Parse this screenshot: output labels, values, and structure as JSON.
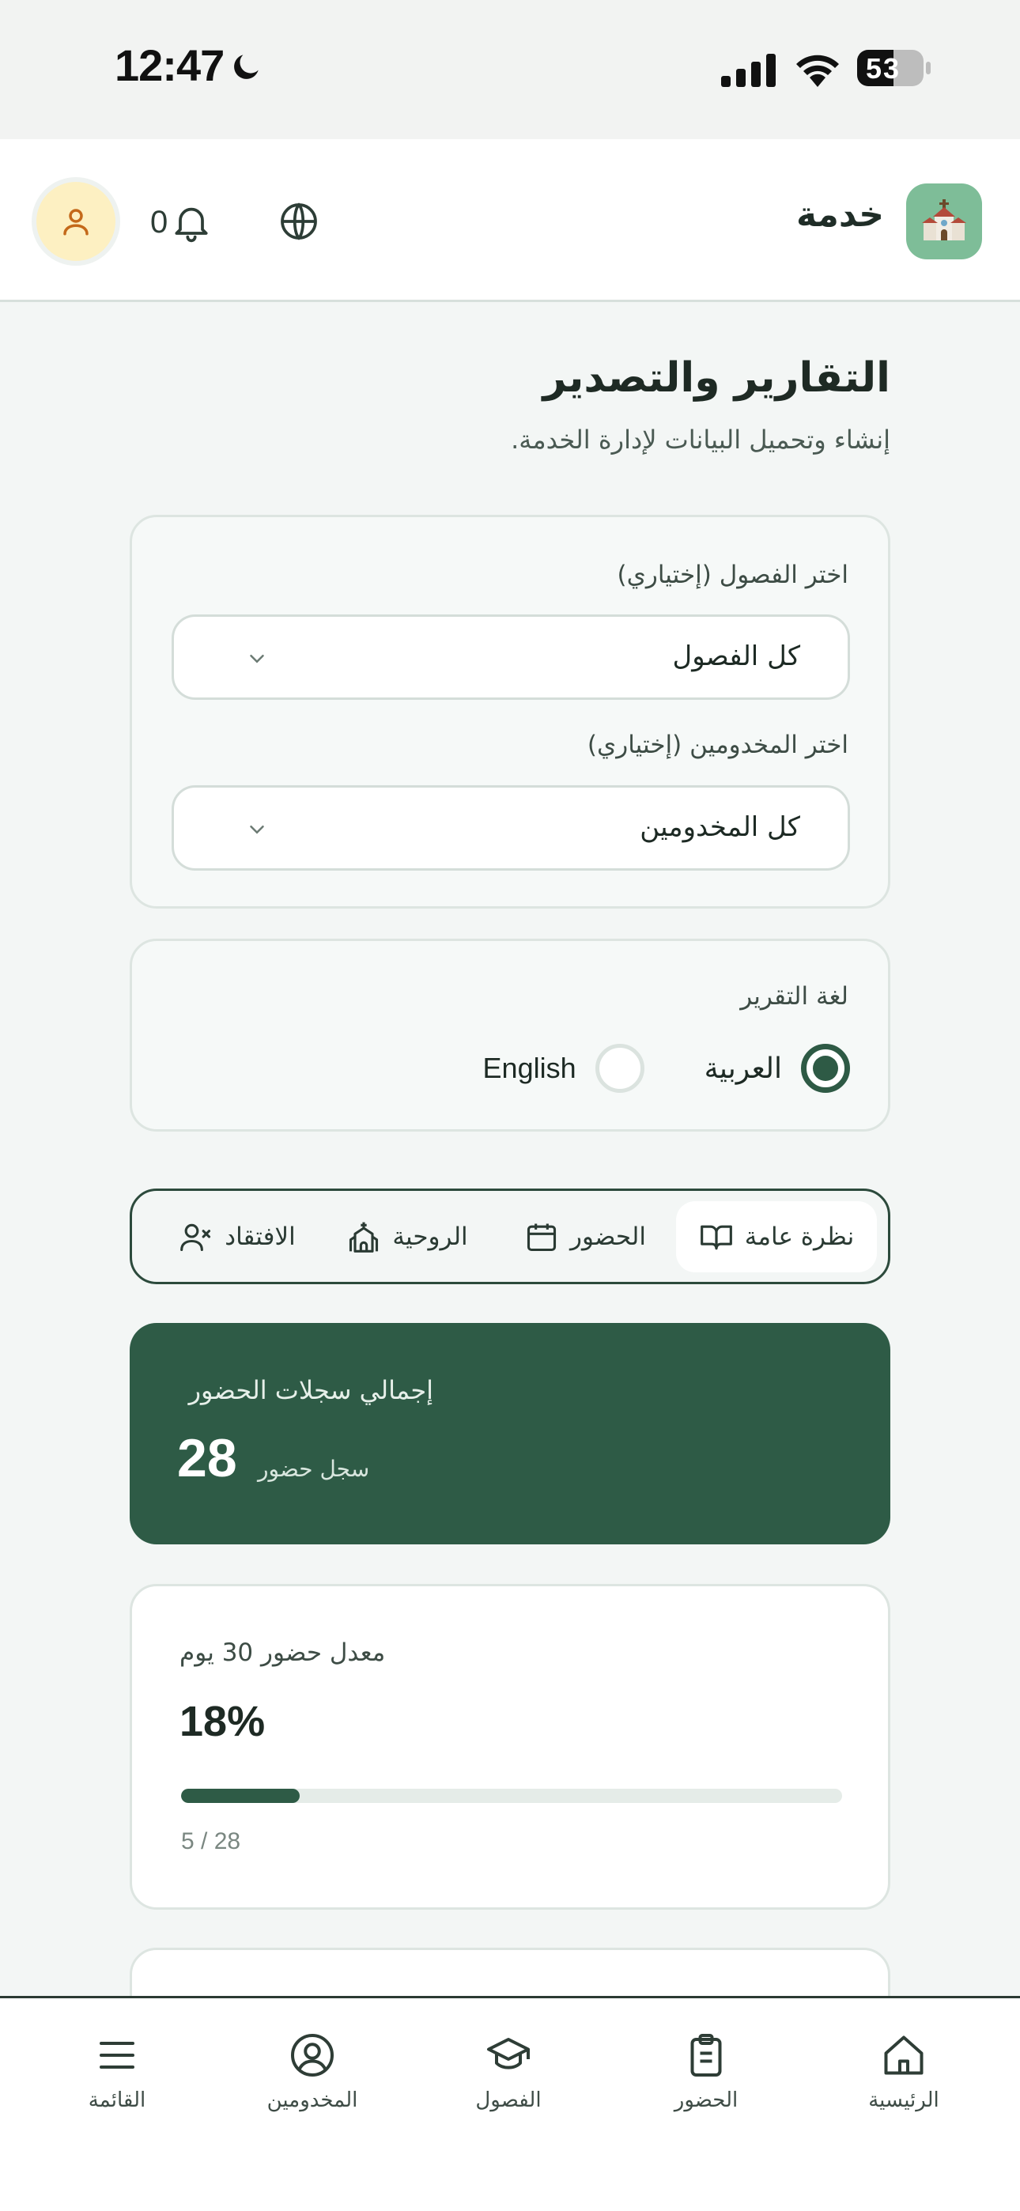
{
  "status_bar": {
    "time": "12:47",
    "battery": "53"
  },
  "header": {
    "brand": "خدمة",
    "notification_count": "0"
  },
  "page": {
    "title": "التقارير والتصدير",
    "subtitle": "إنشاء وتحميل البيانات لإدارة الخدمة."
  },
  "filters": {
    "classes_label": "اختر الفصول (إختياري)",
    "classes_value": "كل الفصول",
    "servants_label": "اختر المخدومين (إختياري)",
    "servants_value": "كل المخدومين"
  },
  "language": {
    "label": "لغة التقرير",
    "options": [
      {
        "label": "العربية",
        "selected": true
      },
      {
        "label": "English",
        "selected": false
      }
    ]
  },
  "tabs": [
    {
      "label": "نظرة عامة",
      "icon": "book-open-icon",
      "active": true
    },
    {
      "label": "الحضور",
      "icon": "calendar-icon",
      "active": false
    },
    {
      "label": "الروحية",
      "icon": "church-icon",
      "active": false
    },
    {
      "label": "الافتقاد",
      "icon": "user-x-icon",
      "active": false
    }
  ],
  "stats": {
    "total": {
      "label": "إجمالي سجلات الحضور",
      "value": "28",
      "unit": "سجل حضور"
    },
    "rate": {
      "label": "معدل حضور 30 يوم",
      "value": "18%",
      "progress": 0.18,
      "ratio": "5 / 28"
    }
  },
  "bottom_nav": [
    {
      "label": "الرئيسية",
      "icon": "home-icon"
    },
    {
      "label": "الحضور",
      "icon": "clipboard-icon"
    },
    {
      "label": "الفصول",
      "icon": "graduation-cap-icon"
    },
    {
      "label": "المخدومين",
      "icon": "user-circle-icon"
    },
    {
      "label": "القائمة",
      "icon": "menu-icon"
    }
  ],
  "colors": {
    "primary": "#2e5b46",
    "avatar_bg": "#fdf0c2",
    "logo_bg": "#7ebd98"
  }
}
